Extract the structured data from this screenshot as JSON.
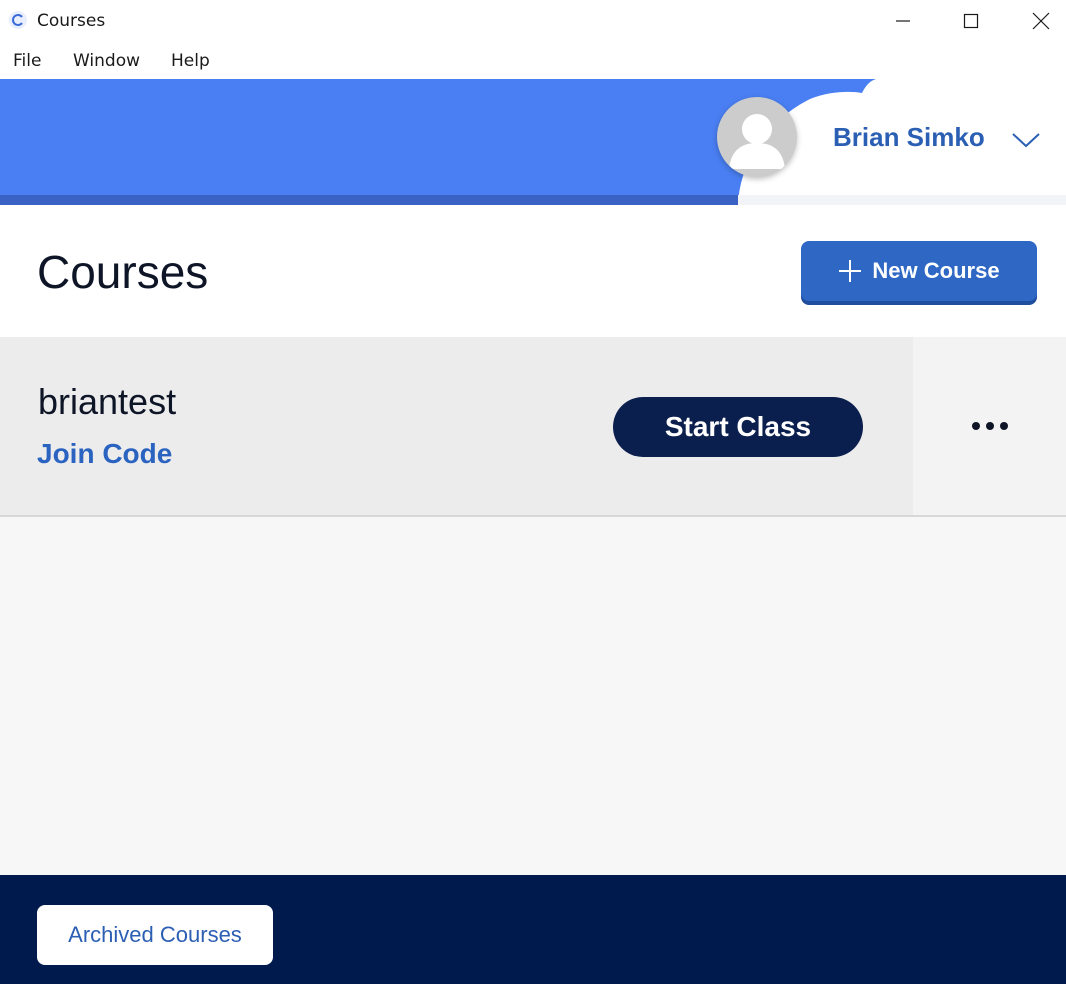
{
  "window": {
    "title": "Courses"
  },
  "menu": {
    "file": "File",
    "window": "Window",
    "help": "Help"
  },
  "header": {
    "user_name": "Brian Simko"
  },
  "page": {
    "title": "Courses",
    "new_course_label": "New Course"
  },
  "course": {
    "name": "briantest",
    "join_code_label": "Join Code",
    "start_class_label": "Start Class"
  },
  "footer": {
    "archived_label": "Archived Courses"
  },
  "colors": {
    "header_blue": "#4a7ff3",
    "primary_button": "#2f67c4",
    "start_class": "#0b1f4e",
    "footer_navy": "#001a4d",
    "link_blue": "#2b63c0"
  },
  "icons": [
    "app-icon",
    "minimize-icon",
    "maximize-icon",
    "close-icon",
    "user-avatar-icon",
    "chevron-down-icon",
    "plus-icon",
    "more-options-icon"
  ]
}
